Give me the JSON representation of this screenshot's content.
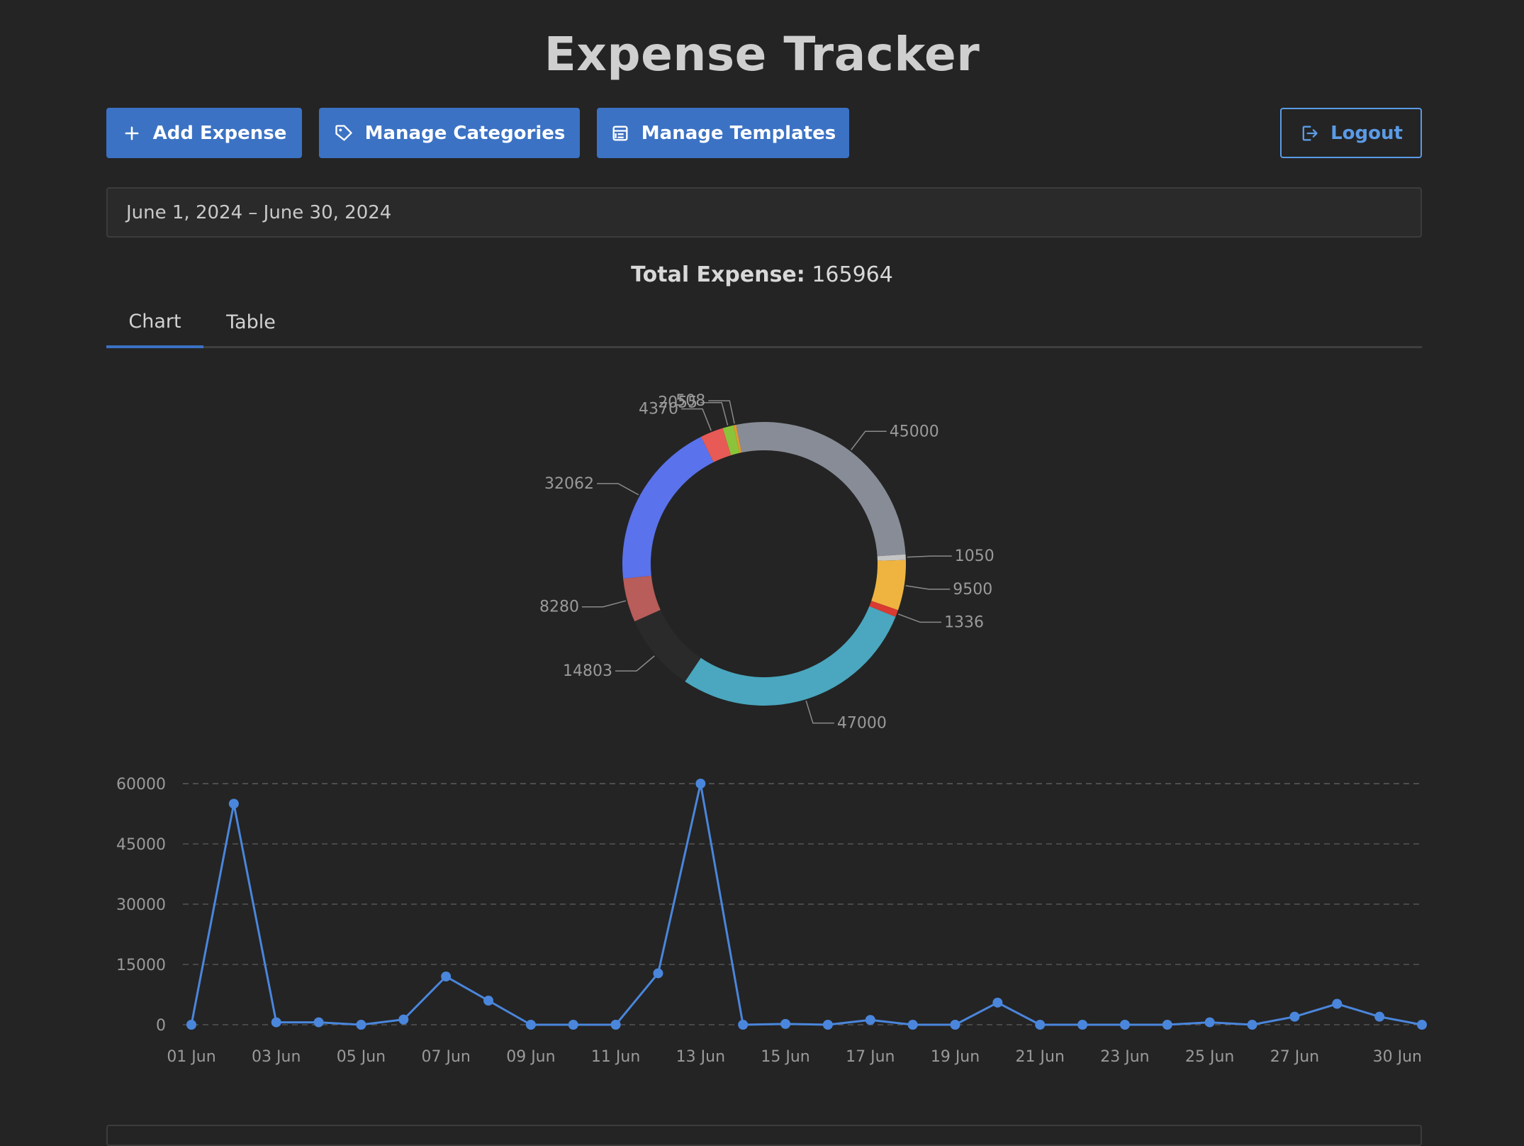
{
  "app": {
    "title": "Expense Tracker"
  },
  "toolbar": {
    "add_expense": "Add Expense",
    "manage_categories": "Manage Categories",
    "manage_templates": "Manage Templates",
    "logout": "Logout"
  },
  "date_range": {
    "value": "June 1, 2024 – June 30, 2024"
  },
  "summary": {
    "total_label": "Total Expense:",
    "total_value": "165964"
  },
  "tabs": [
    {
      "label": "Chart",
      "active": true
    },
    {
      "label": "Table",
      "active": false
    }
  ],
  "colors": {
    "accent": "#3b72c4",
    "line": "#4a86dc",
    "outline": "#5b9be6"
  },
  "chart_data": [
    {
      "type": "pie",
      "variant": "donut",
      "slices": [
        {
          "value": 45000,
          "color": "#878c96"
        },
        {
          "value": 1050,
          "color": "#c4c4c4"
        },
        {
          "value": 9500,
          "color": "#efb440"
        },
        {
          "value": 1336,
          "color": "#d93a32"
        },
        {
          "value": 47000,
          "color": "#4aa7bf"
        },
        {
          "value": 14803,
          "color": "#2a2a2a"
        },
        {
          "value": 8280,
          "color": "#b85d5a"
        },
        {
          "value": 32062,
          "color": "#5a72ec"
        },
        {
          "value": 4370,
          "color": "#e85a55"
        },
        {
          "value": 2055,
          "color": "#8bc43a"
        },
        {
          "value": 508,
          "color": "#e09a30"
        }
      ]
    },
    {
      "type": "line",
      "x": [
        "01 Jun",
        "02 Jun",
        "03 Jun",
        "04 Jun",
        "05 Jun",
        "06 Jun",
        "07 Jun",
        "08 Jun",
        "09 Jun",
        "10 Jun",
        "11 Jun",
        "12 Jun",
        "13 Jun",
        "14 Jun",
        "15 Jun",
        "16 Jun",
        "17 Jun",
        "18 Jun",
        "19 Jun",
        "20 Jun",
        "21 Jun",
        "22 Jun",
        "23 Jun",
        "24 Jun",
        "25 Jun",
        "26 Jun",
        "27 Jun",
        "28 Jun",
        "29 Jun",
        "30 Jun"
      ],
      "x_tick_labels": [
        "01 Jun",
        "03 Jun",
        "05 Jun",
        "07 Jun",
        "09 Jun",
        "11 Jun",
        "13 Jun",
        "15 Jun",
        "17 Jun",
        "19 Jun",
        "21 Jun",
        "23 Jun",
        "25 Jun",
        "27 Jun",
        "30 Jun"
      ],
      "values": [
        0,
        55000,
        600,
        600,
        0,
        1300,
        12000,
        6000,
        0,
        0,
        0,
        12800,
        60000,
        0,
        200,
        0,
        1200,
        0,
        0,
        5500,
        0,
        0,
        0,
        0,
        600,
        0,
        2000,
        5200,
        2000,
        0
      ],
      "yticks": [
        0,
        15000,
        30000,
        45000,
        60000
      ],
      "ylim": [
        0,
        60000
      ],
      "grid": true
    }
  ]
}
